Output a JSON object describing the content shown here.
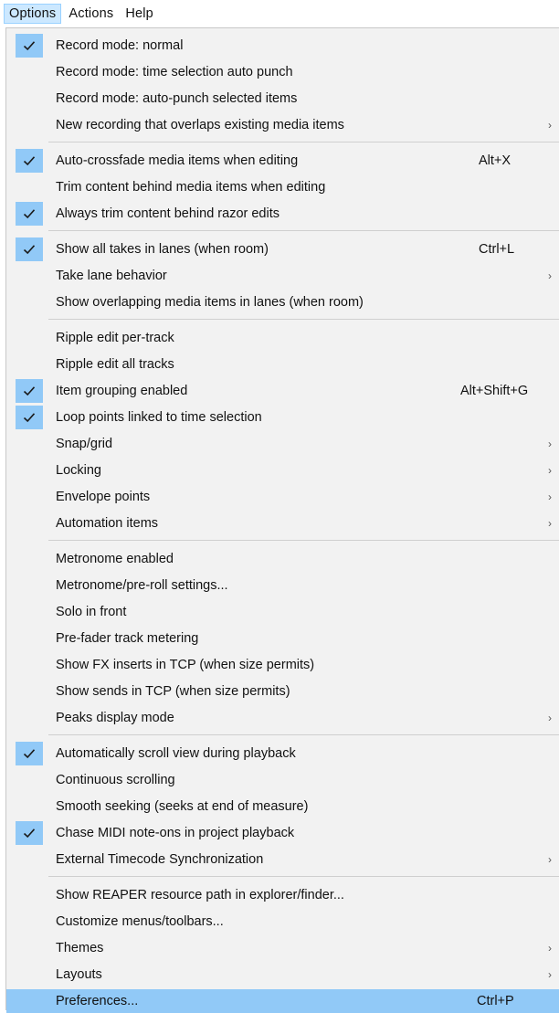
{
  "menubar": {
    "items": [
      {
        "label": "Options",
        "active": true
      },
      {
        "label": "Actions",
        "active": false
      },
      {
        "label": "Help",
        "active": false
      }
    ]
  },
  "colors": {
    "check_bg": "#91c9f7",
    "highlight_bg": "#91c9f7",
    "menu_bg": "#f2f2f2",
    "active_menubar_bg": "#cce8ff"
  },
  "icons": {
    "check": "check-icon",
    "submenu": "chevron-right-icon"
  },
  "menu": {
    "groups": [
      {
        "items": [
          {
            "label": "Record mode: normal",
            "checked": true
          },
          {
            "label": "Record mode: time selection auto punch"
          },
          {
            "label": "Record mode: auto-punch selected items"
          },
          {
            "label": "New recording that overlaps existing media items",
            "submenu": true
          }
        ]
      },
      {
        "items": [
          {
            "label": "Auto-crossfade media items when editing",
            "checked": true,
            "shortcut": "Alt+X"
          },
          {
            "label": "Trim content behind media items when editing"
          },
          {
            "label": "Always trim content behind razor edits",
            "checked": true
          }
        ]
      },
      {
        "items": [
          {
            "label": "Show all takes in lanes (when room)",
            "checked": true,
            "shortcut": "Ctrl+L"
          },
          {
            "label": "Take lane behavior",
            "submenu": true
          },
          {
            "label": "Show overlapping media items in lanes (when room)"
          }
        ]
      },
      {
        "items": [
          {
            "label": "Ripple edit per-track"
          },
          {
            "label": "Ripple edit all tracks"
          },
          {
            "label": "Item grouping enabled",
            "checked": true,
            "shortcut": "Alt+Shift+G"
          },
          {
            "label": "Loop points linked to time selection",
            "checked": true
          },
          {
            "label": "Snap/grid",
            "submenu": true
          },
          {
            "label": "Locking",
            "submenu": true
          },
          {
            "label": "Envelope points",
            "submenu": true
          },
          {
            "label": "Automation items",
            "submenu": true
          }
        ]
      },
      {
        "items": [
          {
            "label": "Metronome enabled"
          },
          {
            "label": "Metronome/pre-roll settings..."
          },
          {
            "label": "Solo in front"
          },
          {
            "label": "Pre-fader track metering"
          },
          {
            "label": "Show FX inserts in TCP (when size permits)"
          },
          {
            "label": "Show sends in TCP (when size permits)"
          },
          {
            "label": "Peaks display mode",
            "submenu": true
          }
        ]
      },
      {
        "items": [
          {
            "label": "Automatically scroll view during playback",
            "checked": true
          },
          {
            "label": "Continuous scrolling"
          },
          {
            "label": "Smooth seeking (seeks at end of measure)"
          },
          {
            "label": "Chase MIDI note-ons in project playback",
            "checked": true
          },
          {
            "label": "External Timecode Synchronization",
            "submenu": true
          }
        ]
      },
      {
        "items": [
          {
            "label": "Show REAPER resource path in explorer/finder..."
          },
          {
            "label": "Customize menus/toolbars..."
          },
          {
            "label": "Themes",
            "submenu": true
          },
          {
            "label": "Layouts",
            "submenu": true
          },
          {
            "label": "Preferences...",
            "shortcut": "Ctrl+P",
            "highlighted": true
          }
        ]
      }
    ]
  }
}
